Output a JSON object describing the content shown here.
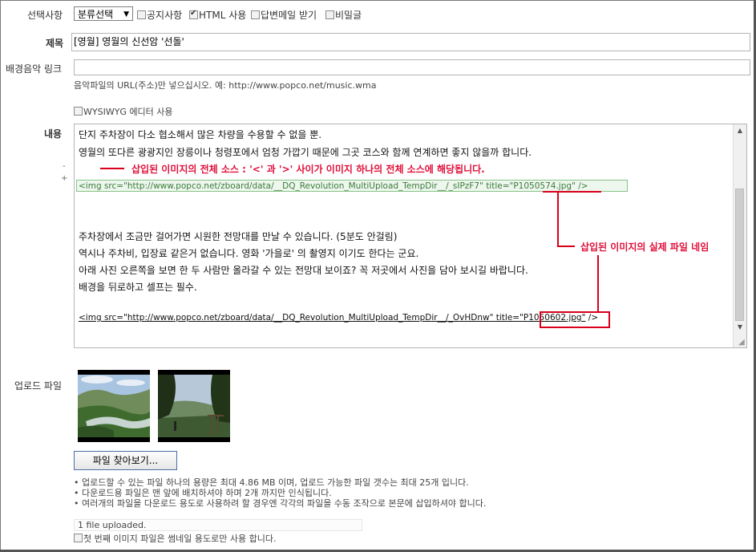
{
  "form": {
    "options_label": "선택사항",
    "category_select": "분류선택",
    "notice_label": "공지사항",
    "notice_checked": false,
    "html_label": "HTML 사용",
    "html_checked": true,
    "reply_mail_label": "답변메일 받기",
    "reply_mail_checked": false,
    "secret_label": "비밀글",
    "secret_checked": false,
    "title_label": "제목",
    "title_value": "[영월] 영월의 신선암 '선돌'",
    "bgm_label": "배경음악 링크",
    "bgm_value": "",
    "bgm_hint": "음악파일의 URL(주소)만 넣으십시오. 예: http://www.popco.net/music.wma",
    "wysiwyg_label": "WYSIWYG 에디터 사용",
    "wysiwyg_checked": false,
    "content_label": "내용",
    "minus": "-",
    "plus": "+",
    "upload_label": "업로드 파일",
    "browse_button": "파일 찾아보기...",
    "upload_notes": [
      "• 업로드할 수 있는 파일 하나의 용량은 최대 4.86 MB 이며, 업로드 가능한 파일 갯수는 최대 25개 입니다.",
      "• 다운로드용 파일은 맨 앞에 배치하셔야 하며 2개 까지만 인식됩니다.",
      "• 여러개의 파일을 다운로드 용도로 사용하려 할 경우엔 각각의 파일을 수동 조작으로 본문에 삽입하셔야 합니다."
    ],
    "upload_status": "1 file uploaded.",
    "thumb_only_label": "첫 번째 이미지 파일은 썸네일 용도로만 사용 합니다.",
    "thumb_only_checked": false
  },
  "editor": {
    "line1": "단지 주차장이 다소 협소해서 많은 차량을 수용할 수 없을 뿐.",
    "line2": "영월의 또다른 광광지인 장릉이나 청령포에서 엄청 가깝기 때문에 그곳 코스와 함께 연계하면 좋지 않을까 합니다.",
    "img_tag1": "<img src=\"http://www.popco.net/zboard/data/__DQ_Revolution_MultiUpload_TempDir__/_sIPzF7\" title=\"P1050574.jpg\" />",
    "line3": "주차장에서 조금만 걸어가면 시원한 전망대를 만날 수 있습니다. (5분도 안걸림)",
    "line4": "역시나 주차비, 입장료 같은거 없습니다. 영화 '가을로' 의 촬영지 이기도 한다는 군요.",
    "line5": "아래 사진 오른쪽을 보면 한 두 사람만 올라갈 수 있는 전망대 보이죠? 꼭 저곳에서 사진을 담아 보시길 바랍니다.",
    "line6": "배경을 뒤로하고 셀프는 필수.",
    "img_tag2_prefix": "<img src=\"http://www.popco.net/zboard/data/__DQ_Revolution_MultiUpload_TempDir__/_OvHDnw\" title=\"",
    "img_tag2_file": "P1050602.jpg\"",
    "img_tag2_suffix": " />"
  },
  "annotations": {
    "source_note": "삽입된 이미지의 전체 소스 : '<'  과  '>'  사이가 이미지 하나의 전체 소스에 해당됩니다.",
    "filename_note": "삽입된 이미지의 실제 파일 네임",
    "color": "#d9001b"
  },
  "thumbnails": [
    {
      "name": "river-landscape-thumbnail"
    },
    {
      "name": "observation-deck-thumbnail"
    }
  ]
}
